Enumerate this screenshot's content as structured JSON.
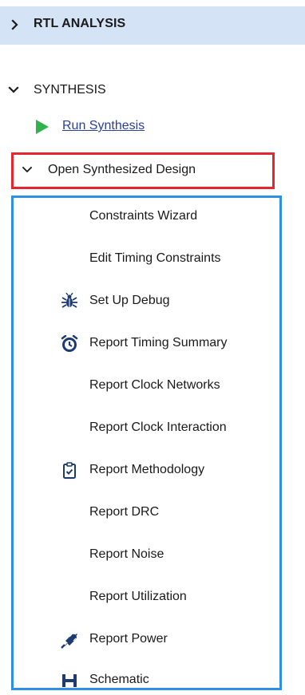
{
  "rtl_analysis": {
    "label": "RTL ANALYSIS"
  },
  "synthesis": {
    "label": "SYNTHESIS",
    "run_synthesis": "Run Synthesis",
    "open_synthesized_design": "Open Synthesized Design",
    "items": [
      {
        "label": "Constraints Wizard",
        "icon": ""
      },
      {
        "label": "Edit Timing Constraints",
        "icon": ""
      },
      {
        "label": "Set Up Debug",
        "icon": "bug-icon"
      },
      {
        "label": "Report Timing Summary",
        "icon": "stopwatch-icon"
      },
      {
        "label": "Report Clock Networks",
        "icon": ""
      },
      {
        "label": "Report Clock Interaction",
        "icon": ""
      },
      {
        "label": "Report Methodology",
        "icon": "clipboard-check-icon"
      },
      {
        "label": "Report DRC",
        "icon": ""
      },
      {
        "label": "Report Noise",
        "icon": ""
      },
      {
        "label": "Report Utilization",
        "icon": ""
      },
      {
        "label": "Report Power",
        "icon": "power-plug-icon"
      },
      {
        "label": "Schematic",
        "icon": "schematic-icon"
      }
    ]
  },
  "colors": {
    "header_bg": "#d4e3f6",
    "link": "#2a3f9a",
    "run_icon": "#2fb34a",
    "highlight_red": "#e5262c",
    "highlight_blue": "#2e8fe3",
    "icon_dark": "#1d3b73"
  }
}
